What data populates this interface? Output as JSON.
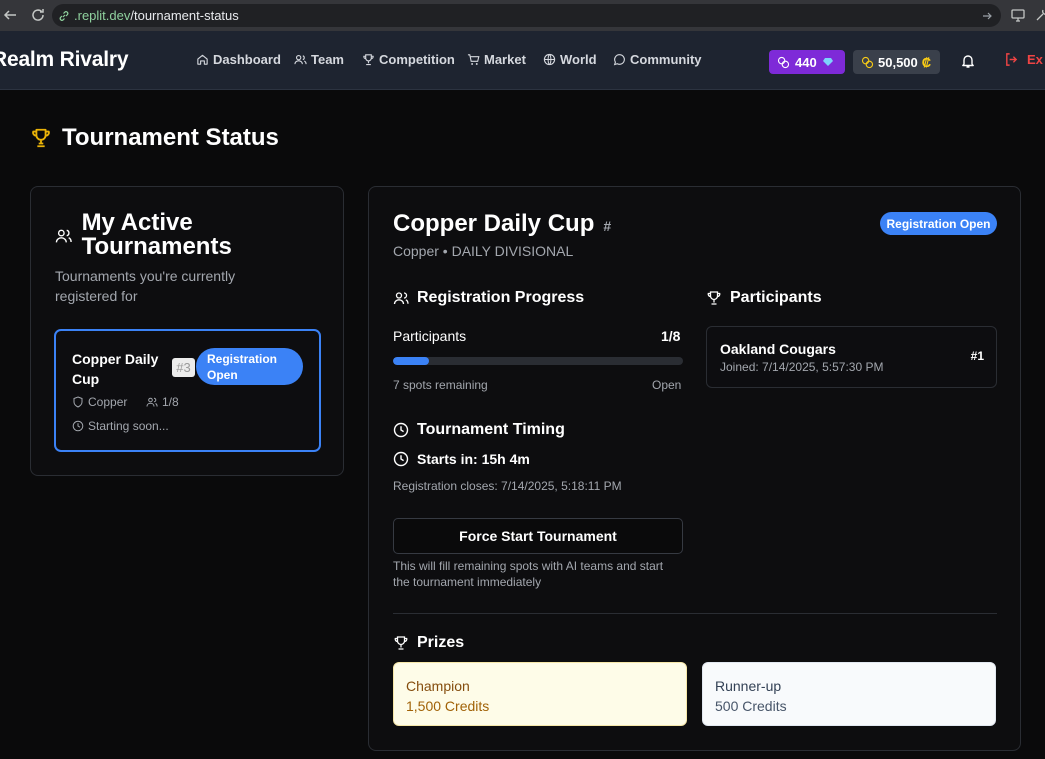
{
  "browser": {
    "url_host": ".replit.dev",
    "url_path": "/tournament-status"
  },
  "navbar": {
    "brand": "Realm Rivalry",
    "items": [
      {
        "label": "Dashboard",
        "icon": "home-icon"
      },
      {
        "label": "Team",
        "icon": "users-icon"
      },
      {
        "label": "Competition",
        "icon": "trophy-icon"
      },
      {
        "label": "Market",
        "icon": "cart-icon"
      },
      {
        "label": "World",
        "icon": "globe-icon"
      },
      {
        "label": "Community",
        "icon": "message-icon"
      }
    ],
    "gems": "440",
    "credits": "50,500",
    "credit_symbol": "₡",
    "logout_label": "Ex",
    "gem_color": "#7e2ad8",
    "accent_color": "#3b82f6"
  },
  "page": {
    "title": "Tournament Status"
  },
  "my_tournaments": {
    "title": "My Active Tournaments",
    "subtitle": "Tournaments you're currently registered for",
    "items": [
      {
        "name": "Copper Daily Cup",
        "number": "#3",
        "status": "Registration Open",
        "division": "Copper",
        "participants": "1/8",
        "timing": "Starting soon..."
      }
    ]
  },
  "tournament": {
    "name": "Copper Daily Cup",
    "hash": "#",
    "status": "Registration Open",
    "subtitle": "Copper • DAILY DIVISIONAL",
    "registration": {
      "heading": "Registration Progress",
      "participants_label": "Participants",
      "participants_value": "1/8",
      "progress_fraction": 0.125,
      "spots_remaining": "7 spots remaining",
      "state": "Open"
    },
    "timing": {
      "heading": "Tournament Timing",
      "starts_in": "Starts in: 15h 4m",
      "registration_closes": "Registration closes: 7/14/2025, 5:18:11 PM",
      "force_start_label": "Force Start Tournament",
      "force_start_note": "This will fill remaining spots with AI teams and start the tournament immediately"
    },
    "participants": {
      "heading": "Participants",
      "list": [
        {
          "name": "Oakland Cougars",
          "joined": "Joined: 7/14/2025, 5:57:30 PM",
          "rank": "#1"
        }
      ]
    },
    "prizes": {
      "heading": "Prizes",
      "list": [
        {
          "place": "Champion",
          "amount": "1,500 Credits"
        },
        {
          "place": "Runner-up",
          "amount": "500 Credits"
        }
      ]
    }
  }
}
